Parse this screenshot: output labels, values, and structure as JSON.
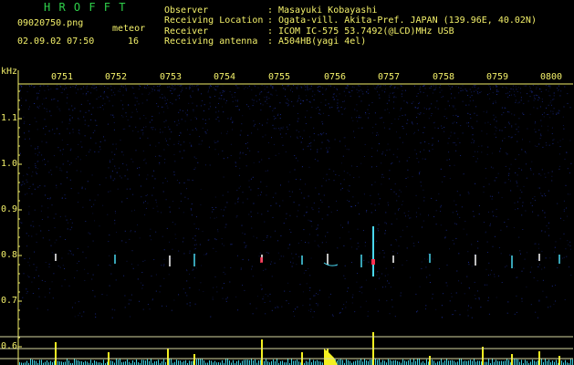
{
  "header": {
    "program_title": "H R O F F T",
    "file_name": "09020750.png",
    "timestamp": "02.09.02 07:50",
    "meteor_label": "meteor",
    "meteor_count": "16"
  },
  "info": [
    {
      "label": "Observer",
      "value": "Masayuki Kobayashi"
    },
    {
      "label": "Receiving Location",
      "value": "Ogata-vill. Akita-Pref. JAPAN (139.96E, 40.02N)"
    },
    {
      "label": "Receiver",
      "value": "ICOM IC-575 53.7492(@LCD)MHz USB"
    },
    {
      "label": "Receiving antenna",
      "value": "A504HB(yagi 4el)"
    }
  ],
  "spectrogram": {
    "unit": "kHz",
    "y_ticks": [
      "1.1",
      "1.0",
      "0.9",
      "0.8",
      "0.7",
      "0.6"
    ],
    "time_ticks": [
      "0751",
      "0752",
      "0753",
      "0754",
      "0755",
      "0756",
      "0757",
      "0758",
      "0759",
      "0800"
    ],
    "colors": {
      "background": "#000000",
      "noise": "#1a2a8c",
      "axis_text": "#f3f06a",
      "title_text": "#2fd14a",
      "signal_peak": "#ff3050",
      "signal_cyan": "#49d8f0",
      "level_yellow": "#f4f020",
      "level_cyan": "#40d0e0",
      "level_line": "#d8d8a0"
    }
  }
}
